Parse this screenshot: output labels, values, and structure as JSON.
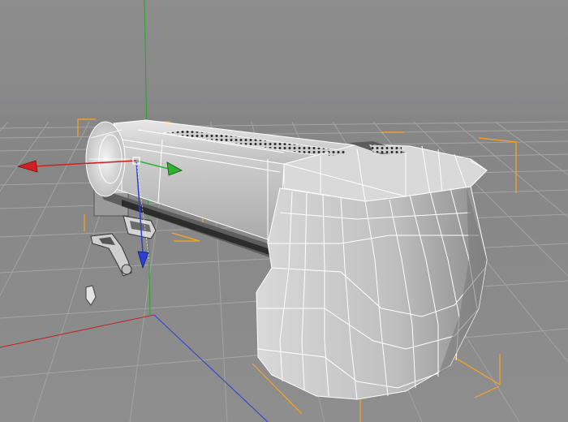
{
  "viewport": {
    "type": "3d-perspective-viewport",
    "background_color": "#8a8a8a",
    "grid_color": "#9a9a9a",
    "horizon_line_color": "#5f7fa8",
    "model": {
      "name": "gun-mesh-wireframe",
      "display_mode": "shaded-with-wireframe",
      "fill_color": "#c9c9c9",
      "edge_color": "#ffffff",
      "selection_bbox_color": "#ffa31a"
    },
    "axes": {
      "x_color": "#cc1f1f",
      "y_color": "#2fb32f",
      "z_color": "#2c3fd6"
    },
    "gizmo": {
      "x_handle": "red-arrow-handle",
      "y_handle": "green-arrow-handle",
      "z_handle": "blue-arrow-handle",
      "center": "white-square-center"
    }
  }
}
